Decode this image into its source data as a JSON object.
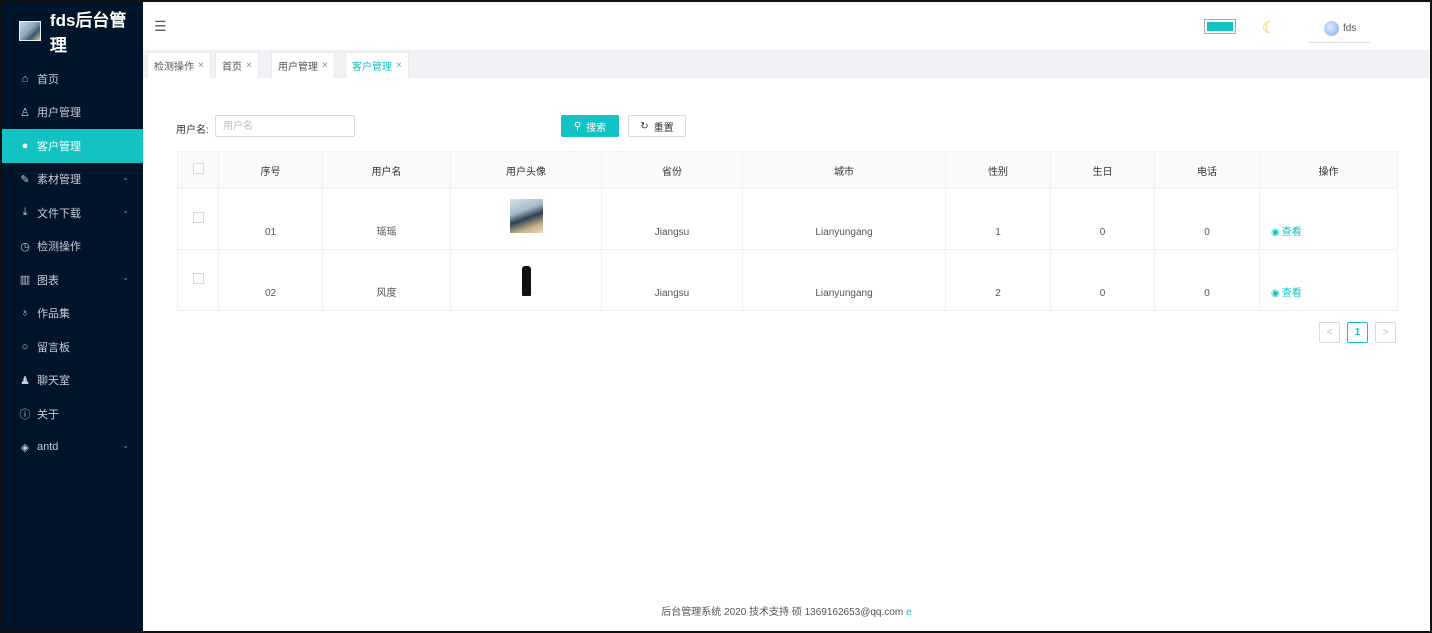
{
  "app": {
    "title": "fds后台管理"
  },
  "sidebar": {
    "items": [
      {
        "label": "首页",
        "icon": "⌂"
      },
      {
        "label": "用户管理",
        "icon": "♙"
      },
      {
        "label": "客户管理",
        "icon": "●"
      },
      {
        "label": "素材管理",
        "icon": "✎"
      },
      {
        "label": "文件下载",
        "icon": "⤓"
      },
      {
        "label": "检测操作",
        "icon": "◷"
      },
      {
        "label": "图表",
        "icon": "▥"
      },
      {
        "label": "作品集",
        "icon": "♁"
      },
      {
        "label": "留言板",
        "icon": "○"
      },
      {
        "label": "聊天室",
        "icon": "♟"
      },
      {
        "label": "关于",
        "icon": "ⓘ"
      },
      {
        "label": "antd",
        "icon": "◈"
      }
    ],
    "active_index": 2
  },
  "header": {
    "user_name": "fds",
    "accent_color": "#13c2c2"
  },
  "tabs": [
    {
      "label": "检测操作",
      "close": "×"
    },
    {
      "label": "首页",
      "close": "×"
    },
    {
      "label": "用户管理",
      "close": "×"
    },
    {
      "label": "客户管理",
      "close": "×"
    }
  ],
  "search": {
    "label": "用户名:",
    "placeholder": "用户名",
    "search_label": "搜索",
    "reset_label": "重置"
  },
  "table": {
    "columns": [
      "序号",
      "用户名",
      "用户头像",
      "省份",
      "城市",
      "性别",
      "生日",
      "电话",
      "操作"
    ],
    "rows": [
      {
        "id": "01",
        "name": "瑶瑶",
        "province": "Jiangsu",
        "city": "Lianyungang",
        "gender": "1",
        "birthday": "0",
        "phone": "0",
        "action": "查看"
      },
      {
        "id": "02",
        "name": "风度",
        "province": "Jiangsu",
        "city": "Lianyungang",
        "gender": "2",
        "birthday": "0",
        "phone": "0",
        "action": "查看"
      }
    ]
  },
  "pagination": {
    "prev": "<",
    "current": "1",
    "next": ">"
  },
  "footer": {
    "text": "后台管理系统 2020 技术支持 硕 1369162653@qq.com"
  }
}
